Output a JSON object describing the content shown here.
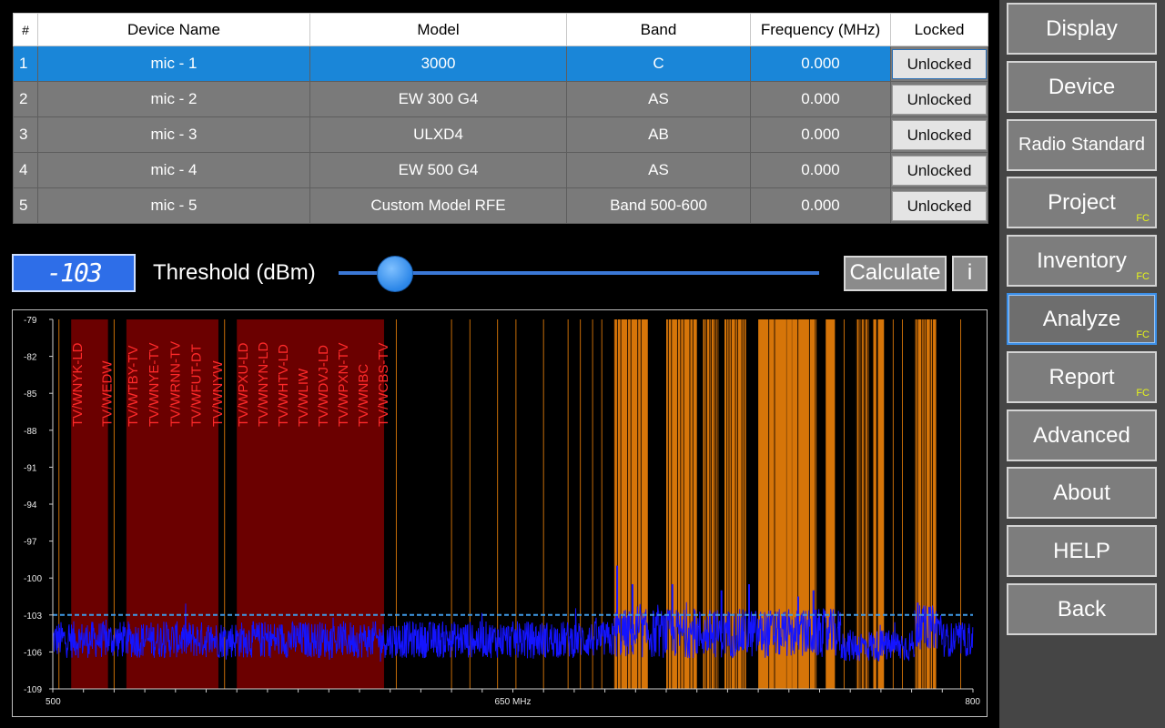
{
  "table": {
    "headers": {
      "num": "#",
      "name": "Device Name",
      "model": "Model",
      "band": "Band",
      "frequency": "Frequency (MHz)",
      "locked": "Locked"
    },
    "rows": [
      {
        "num": "1",
        "name": "mic - 1",
        "model": "3000",
        "band": "C",
        "frequency": "0.000",
        "locked": "Unlocked",
        "selected": true
      },
      {
        "num": "2",
        "name": "mic - 2",
        "model": "EW 300 G4",
        "band": "AS",
        "frequency": "0.000",
        "locked": "Unlocked"
      },
      {
        "num": "3",
        "name": "mic - 3",
        "model": "ULXD4",
        "band": "AB",
        "frequency": "0.000",
        "locked": "Unlocked"
      },
      {
        "num": "4",
        "name": "mic - 4",
        "model": "EW 500 G4",
        "band": "AS",
        "frequency": "0.000",
        "locked": "Unlocked"
      },
      {
        "num": "5",
        "name": "mic - 5",
        "model": "Custom Model RFE",
        "band": "Band 500-600",
        "frequency": "0.000",
        "locked": "Unlocked"
      }
    ]
  },
  "threshold": {
    "value": "-103",
    "label": "Threshold (dBm)",
    "slider_fraction": 0.115
  },
  "buttons": {
    "calculate": "Calculate",
    "info": "i"
  },
  "colors": {
    "tv_band": "#6b0000",
    "tv_label": "#ff2a2a",
    "occupied": "#e87f0a",
    "trace": "#1414ff",
    "threshold_line": "#3f9be8",
    "selected_row": "#1a86d8"
  },
  "nav": [
    {
      "label": "Display"
    },
    {
      "label": "Device"
    },
    {
      "label": "Radio Standard",
      "small": true
    },
    {
      "label": "Project",
      "badge": "FC"
    },
    {
      "label": "Inventory",
      "badge": "FC"
    },
    {
      "label": "Analyze",
      "badge": "FC",
      "active": true
    },
    {
      "label": "Report",
      "badge": "FC"
    },
    {
      "label": "Advanced"
    },
    {
      "label": "About"
    },
    {
      "label": "HELP"
    },
    {
      "label": "Back"
    }
  ],
  "chart_data": {
    "type": "line",
    "x_unit": "MHz",
    "xlim": [
      500,
      800
    ],
    "ylim": [
      -109,
      -79
    ],
    "yticks": [
      -79,
      -82,
      -85,
      -88,
      -91,
      -94,
      -97,
      -100,
      -103,
      -106,
      -109
    ],
    "xtick_labels": [
      {
        "value": 500,
        "label": "500"
      },
      {
        "value": 650,
        "label": "650 MHz"
      },
      {
        "value": 800,
        "label": "800"
      }
    ],
    "threshold": -103,
    "tv_channels": [
      {
        "start": 506,
        "end": 518,
        "labels": [
          "TV/WNYK-LD",
          "TV/WEDW"
        ]
      },
      {
        "start": 524,
        "end": 554,
        "labels": [
          "TV/WTBY-TV",
          "TV/WNYE-TV",
          "TV/WRNN-TV",
          "TV/WFUT-DT",
          "TV/WNYW"
        ]
      },
      {
        "start": 560,
        "end": 608,
        "labels": [
          "TV/WPXU-LD",
          "TV/WNYN-LD",
          "TV/WHTV-LD",
          "TV/WLIW",
          "TV/WDVJ-LD",
          "TV/WPXN-TV",
          "TV/WNBC",
          "TV/WCBS-TV"
        ]
      }
    ],
    "occupied_bands": [
      [
        683,
        694
      ],
      [
        700,
        710
      ],
      [
        712,
        717
      ],
      [
        719,
        726
      ],
      [
        730,
        749
      ],
      [
        752,
        755
      ],
      [
        762,
        766
      ],
      [
        767.5,
        768.5
      ],
      [
        769,
        771
      ],
      [
        781,
        788
      ]
    ],
    "occupied_lines": [
      502,
      520,
      556,
      612,
      630,
      636,
      645,
      651,
      660,
      668,
      672,
      676,
      679,
      739,
      741,
      758,
      774,
      777,
      796
    ],
    "series": [
      {
        "segments": [
          {
            "x": [
              500,
              683
            ],
            "level": -105.0,
            "spread": 1.5
          },
          {
            "x": [
              683,
              757
            ],
            "level": -104.5,
            "spread": 2.0,
            "peaks": [
              [
                684,
                -99
              ],
              [
                689,
                -100.5
              ],
              [
                702,
                -100.5
              ],
              [
                718,
                -101
              ],
              [
                727,
                -100.5
              ],
              [
                743,
                -101.5
              ],
              [
                748,
                -101
              ]
            ]
          },
          {
            "x": [
              757,
              781
            ],
            "level": -105.5,
            "spread": 1.3
          },
          {
            "x": [
              781,
              790
            ],
            "level": -104.0,
            "spread": 1.8,
            "peaks": [
              [
                782,
                -102
              ]
            ]
          },
          {
            "x": [
              790,
              800
            ],
            "level": -105.0,
            "spread": 1.4
          }
        ]
      }
    ]
  }
}
